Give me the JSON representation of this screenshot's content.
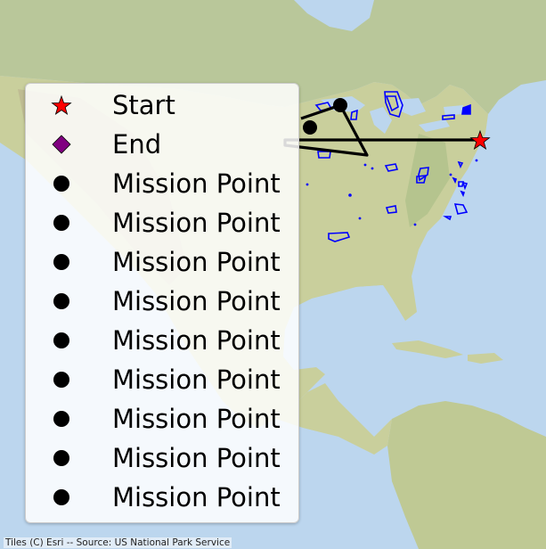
{
  "legend": {
    "items": [
      {
        "label": "Start",
        "marker": "red-star",
        "color": "#ff0000"
      },
      {
        "label": "End",
        "marker": "purple-diamond",
        "color": "#800080"
      },
      {
        "label": "Mission Point",
        "marker": "black-circle",
        "color": "#000000"
      },
      {
        "label": "Mission Point",
        "marker": "black-circle",
        "color": "#000000"
      },
      {
        "label": "Mission Point",
        "marker": "black-circle",
        "color": "#000000"
      },
      {
        "label": "Mission Point",
        "marker": "black-circle",
        "color": "#000000"
      },
      {
        "label": "Mission Point",
        "marker": "black-circle",
        "color": "#000000"
      },
      {
        "label": "Mission Point",
        "marker": "black-circle",
        "color": "#000000"
      },
      {
        "label": "Mission Point",
        "marker": "black-circle",
        "color": "#000000"
      },
      {
        "label": "Mission Point",
        "marker": "black-circle",
        "color": "#000000"
      },
      {
        "label": "Mission Point",
        "marker": "black-circle",
        "color": "#000000"
      }
    ]
  },
  "attribution": "Tiles (C) Esri -- Source: US National Park Service",
  "colors": {
    "route": "#000000",
    "park_outline": "#0000ff",
    "start": "#ff0000",
    "end": "#800080",
    "ocean": "#bcd6ee"
  }
}
